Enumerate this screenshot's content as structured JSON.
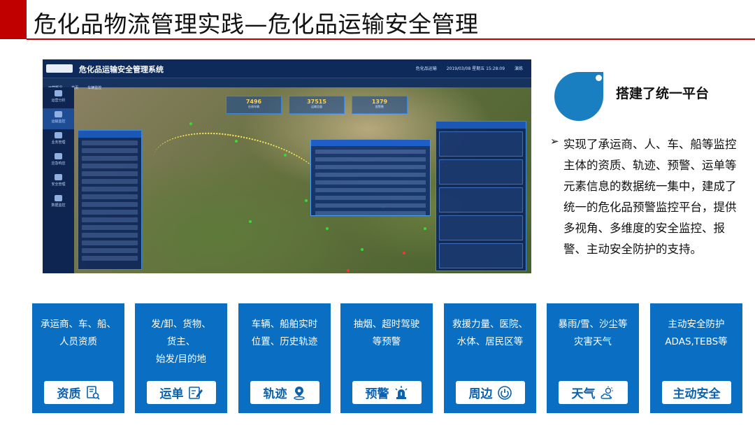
{
  "page": {
    "title": "危化品物流管理实践—危化品运输安全管理"
  },
  "screenshot": {
    "app_title": "危化品运输安全管理系统",
    "top_info": [
      "危化品运输",
      "2019/03/08 星期五 15:28:09",
      "演练"
    ],
    "tabs": [
      "运营概况",
      "首页",
      "车辆监控"
    ],
    "sidebar": [
      "运营分析",
      "运输监控",
      "业务管理",
      "应急响应",
      "安全管理",
      "数据监控"
    ],
    "kpis": [
      {
        "value": "7496",
        "label": "在线车辆"
      },
      {
        "value": "37515",
        "label": "运输总量"
      },
      {
        "value": "1379",
        "label": "报警数"
      }
    ]
  },
  "platform": {
    "heading": "搭建了统一平台",
    "arrow": "➢",
    "description": "实现了承运商、人、车、船等监控主体的资质、轨迹、预警、运单等元素信息的数据统一集中，建成了统一的危化品预警监控平台，提供多视角、多维度的安全监控、报警、主动安全防护的支持。"
  },
  "cards": [
    {
      "text": "承运商、车、船、\n人员资质",
      "label": "资质",
      "icon": "document-search-icon"
    },
    {
      "text": "发/卸、货物、\n货主、\n始发/目的地",
      "label": "运单",
      "icon": "edit-document-icon"
    },
    {
      "text": "车辆、船舶实时\n位置、历史轨迹",
      "label": "轨迹",
      "icon": "map-pin-icon"
    },
    {
      "text": "抽烟、超时驾驶\n等预警",
      "label": "预警",
      "icon": "alarm-light-icon"
    },
    {
      "text": "救援力量、医院、\n水体、居民区等",
      "label": "周边",
      "icon": "power-circle-icon"
    },
    {
      "text": "暴雨/雪、沙尘等\n灾害天气",
      "label": "天气",
      "icon": "weather-cloud-icon"
    },
    {
      "text": "主动安全防护\nADAS,TEBS等",
      "label": "主动安全",
      "icon": ""
    }
  ],
  "colors": {
    "accent_red": "#c00000",
    "card_blue": "#0a6fc2",
    "label_blue": "#0a62b0",
    "drop_blue": "#1a7fc0"
  }
}
